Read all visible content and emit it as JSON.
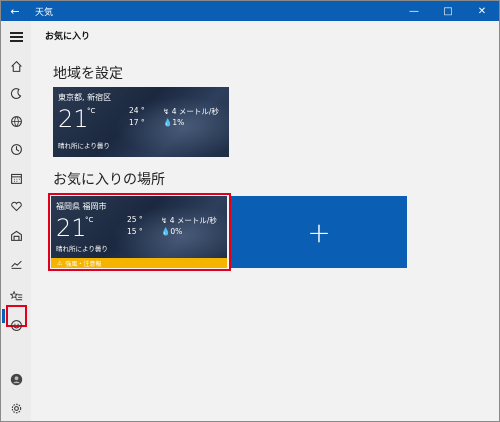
{
  "window": {
    "title": "天気",
    "back_icon": "back-arrow-icon",
    "controls": [
      "minimize-icon",
      "maximize-icon",
      "close-icon"
    ]
  },
  "header": {
    "page_title": "お気に入り"
  },
  "sidebar": {
    "items": [
      {
        "name": "home",
        "icon": "home-icon"
      },
      {
        "name": "forecast",
        "icon": "moon-icon"
      },
      {
        "name": "maps",
        "icon": "globe-icon"
      },
      {
        "name": "history",
        "icon": "clock-icon"
      },
      {
        "name": "calendar",
        "icon": "calendar-icon"
      },
      {
        "name": "news",
        "icon": "heart-icon"
      },
      {
        "name": "places",
        "icon": "building-icon"
      },
      {
        "name": "charts",
        "icon": "chart-icon"
      },
      {
        "name": "favorites",
        "icon": "star-list-icon",
        "active": true
      },
      {
        "name": "feedback",
        "icon": "smile-icon"
      },
      {
        "name": "account",
        "icon": "avatar-icon"
      },
      {
        "name": "settings",
        "icon": "gear-icon"
      }
    ]
  },
  "home_section": {
    "title": "地域を設定",
    "card": {
      "location": "東京都, 新宿区",
      "temp": "21",
      "unit": "°C",
      "high": "24 °",
      "low": "17 °",
      "wind": "4 メートル/秒",
      "rain": "1%",
      "condition": "晴れ所により曇り"
    }
  },
  "favorites_section": {
    "title": "お気に入りの場所",
    "card": {
      "location": "福岡県 福岡市",
      "temp": "21",
      "unit": "°C",
      "high": "25 °",
      "low": "15 °",
      "wind": "4 メートル/秒",
      "rain": "0%",
      "condition": "晴れ所により曇り",
      "alert": "強風・注意報"
    },
    "add_label": "+"
  },
  "colors": {
    "accent": "#0a5fb4",
    "highlight": "#e0001b",
    "alert": "#f4b400"
  }
}
